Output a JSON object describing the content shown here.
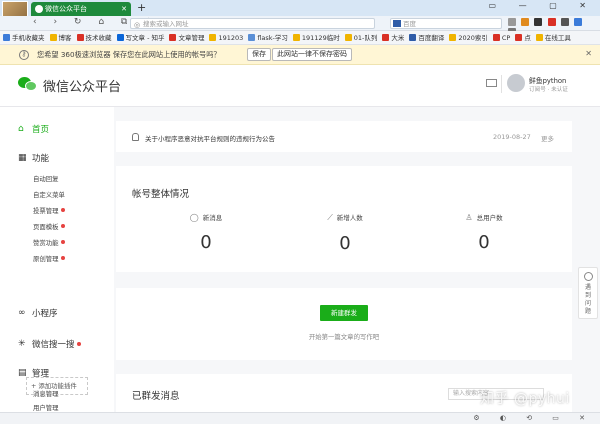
{
  "browser": {
    "tab_title": "微信公众平台",
    "tab_close": "✕",
    "new_tab": "+",
    "window_controls": "▭ — ▢ ✕",
    "nav_icons": "‹ › ↻ ⌂ ⧉ ☆",
    "url_placeholder": "搜索或输入网址",
    "search_engine_placeholder": "百度",
    "bookmarks": [
      {
        "label": "手机收藏夹",
        "color": "#3b7bd9"
      },
      {
        "label": "博客",
        "color": "#f0b400"
      },
      {
        "label": "技术收藏",
        "color": "#d93025"
      },
      {
        "label": "写文章 - 知乎",
        "color": "#0b66d8"
      },
      {
        "label": "文章管理",
        "color": "#d93025"
      },
      {
        "label": "191203",
        "color": "#f0b400"
      },
      {
        "label": "flask-学习",
        "color": "#5a8fd6"
      },
      {
        "label": "191129临时",
        "color": "#f0b400"
      },
      {
        "label": "01-队列",
        "color": "#f0b400"
      },
      {
        "label": "大米",
        "color": "#d93025"
      },
      {
        "label": "百度翻译",
        "color": "#2e5ca8"
      },
      {
        "label": "2020索引",
        "color": "#f0b400"
      },
      {
        "label": "CP",
        "color": "#d93025"
      },
      {
        "label": "点",
        "color": "#d93025"
      },
      {
        "label": "在线工具",
        "color": "#f0b400"
      }
    ]
  },
  "password_notice": {
    "text": "您希望 360极速浏览器 保存您在此网站上使用的帐号吗？",
    "save_label": "保存",
    "never_label": "此网站一律不保存密码",
    "close": "✕"
  },
  "header": {
    "title": "微信公众平台",
    "user_name": "鲜鱼python",
    "user_sub": "订阅号  ·  未认证"
  },
  "sidebar": {
    "home": "首页",
    "functions": "功能",
    "function_items": [
      {
        "label": "自动回复",
        "dot": false
      },
      {
        "label": "自定义菜单",
        "dot": false
      },
      {
        "label": "投票管理",
        "dot": true
      },
      {
        "label": "页面模板",
        "dot": true
      },
      {
        "label": "赞赏功能",
        "dot": true
      },
      {
        "label": "原创管理",
        "dot": true
      }
    ],
    "add_plugin": "+ 添加功能插件",
    "mini_program": "小程序",
    "wechat_search": "微信搜一搜",
    "management": "管理",
    "management_items": [
      "消息管理",
      "用户管理"
    ]
  },
  "announcement": {
    "text": "关于小程序恶意对抗平台规则的违规行为公告",
    "date": "2019-08-27",
    "more": "更多"
  },
  "overview": {
    "title": "帐号整体情况",
    "stats": [
      {
        "label": "新消息",
        "icon": "chat-bubble-icon",
        "glyph": "◯",
        "value": "0"
      },
      {
        "label": "新增人数",
        "icon": "trend-up-icon",
        "glyph": "⟋",
        "value": "0"
      },
      {
        "label": "总用户数",
        "icon": "user-icon",
        "glyph": "♙",
        "value": "0"
      }
    ]
  },
  "mass_send": {
    "button_label": "新建群发",
    "hint": "开始第一篇文章的写作吧"
  },
  "sent": {
    "title": "已群发消息",
    "search_placeholder": "输入搜索内容"
  },
  "feedback": {
    "label": "遇到问题"
  },
  "watermark": "知乎 @pyhui",
  "statusbar_icons": "⚙ ◐ ⟲ ▭ ✕"
}
